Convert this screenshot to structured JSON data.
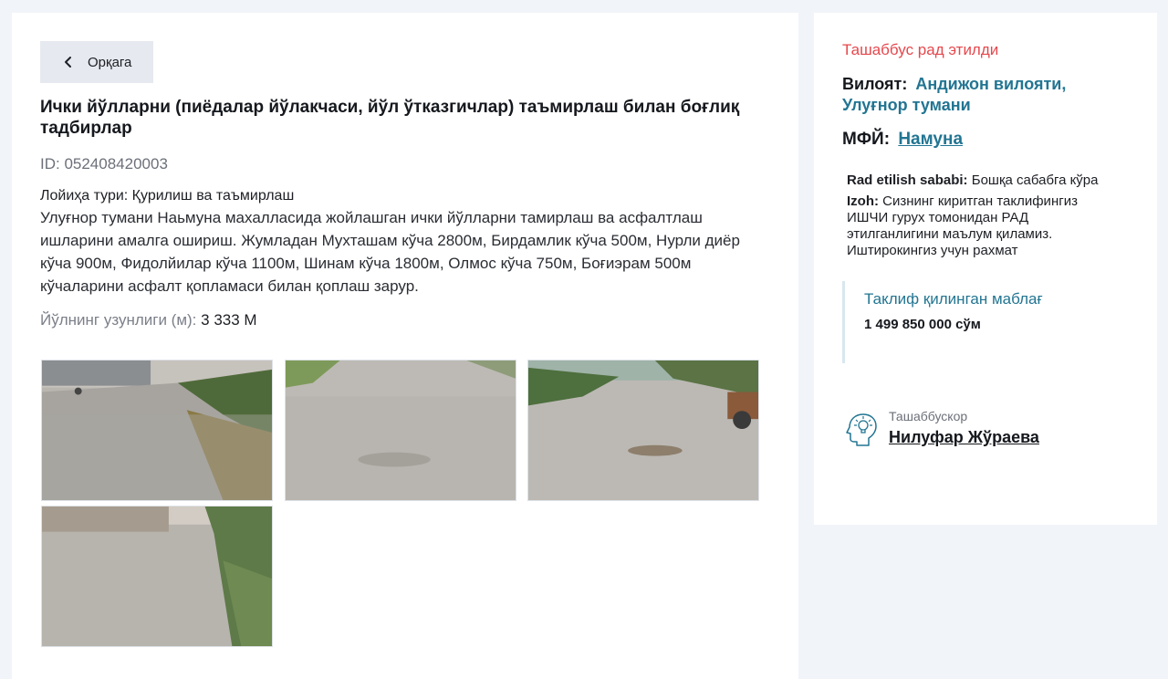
{
  "back_button": {
    "label": "Орқага",
    "icon": "chevron-left-icon"
  },
  "project": {
    "title": "Ички йўлларни (пиёдалар йўлакчаси, йўл ўтказгичлар) таъмирлаш билан боғлиқ тадбирлар",
    "id_text": "ID: 052408420003",
    "type_text": "Лойиҳа тури: Қурилиш ва таъмирлаш",
    "description": "Улуғнор тумани Наьмуна махалласида жойлашган ички йўлларни тамирлаш ва асфалтлаш ишларини амалга ошириш. Жумладан Мухташам кўча 2800м, Бирдамлик кўча 500м, Нурли диёр кўча 900м, Фидолйилар кўча 1100м, Шинам кўча 1800м, Олмос кўча 750м, Боғиэрам 500м кўчаларини асфалт қопламаси билан қоплаш зарур.",
    "road_length_label": "Йўлнинг узунлиги (м):",
    "road_length_value": "3 333 М"
  },
  "photos": [
    {
      "name": "road-photo-1"
    },
    {
      "name": "road-photo-2"
    },
    {
      "name": "road-photo-3"
    },
    {
      "name": "road-photo-4"
    }
  ],
  "sidebar": {
    "status": "Ташаббус рад этилди",
    "status_color": "#e5484d",
    "region_label": "Вилоят:",
    "region_value": "Андижон вилояти, Улуғнор тумани",
    "mfy_label": "МФЙ:",
    "mfy_value": "Намуна",
    "reason_label": "Rad etilish sababi:",
    "reason_value": "Бошқа сабабга кўра",
    "izoh_label": "Izoh:",
    "izoh_value": "Сизнинг киритган таклифингиз ИШЧИ гурух томонидан РАД этилганлигини маълум қиламиз. Иштирокингиз учун рахмат",
    "amount_label": "Таклиф қилинган маблағ",
    "amount_value": "1 499 850 000 сўм",
    "initiator_label": "Ташаббускор",
    "initiator_name": "Нилуфар Жўраева",
    "initiator_icon": "idea-head-icon",
    "accent_color": "#227592"
  }
}
